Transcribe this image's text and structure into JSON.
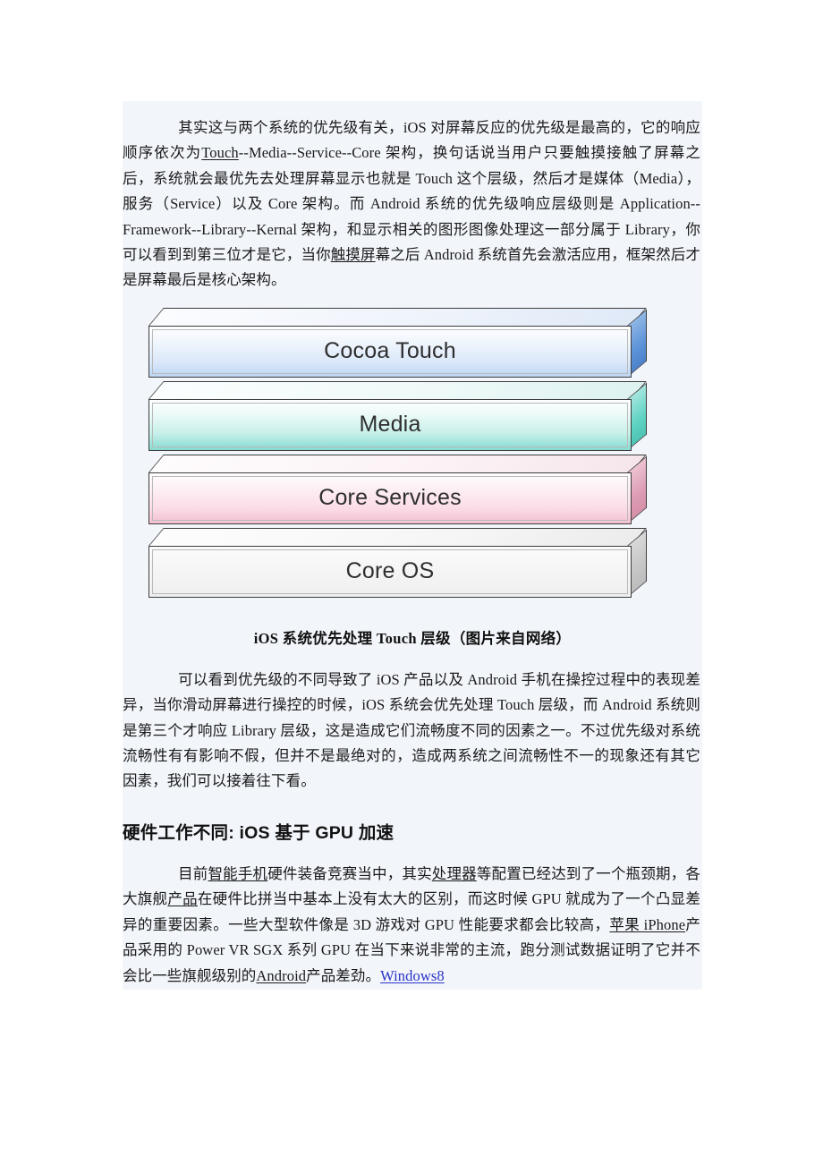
{
  "document": {
    "background_color": "#ffffff",
    "content_block_color": "#f2f5fa",
    "link_color": "#2a33c9"
  },
  "paragraphs": {
    "p1": {
      "seg_a": "其实这与两个系统的优先级有关，iOS 对屏幕反应的优先级是最高的，它的响应顺序依次为",
      "link_touch": "Touch",
      "seg_b": "--Media--Service--Core 架构，换句话说当用户只要触摸接触了屏幕之后，系统就会最优先去处理屏幕显示也就是 Touch 这个层级，然后才是媒体（Media），服务（Service）以及 Core 架构。而 Android 系统的优先级响应层级则是 Application--Framework--Library--Kernal 架构，和显示相关的图形图像处理这一部分属于 Library，你可以看到到第三位才是它，当你",
      "link_touch_screen": "触摸屏",
      "seg_c": "幕之后 Android 系统首先会激活应用，框架然后才是屏幕最后是核心架构。"
    },
    "p2": {
      "text": "可以看到优先级的不同导致了 iOS 产品以及 Android 手机在操控过程中的表现差异，当你滑动屏幕进行操控的时候，iOS 系统会优先处理 Touch 层级，而 Android 系统则是第三个才响应 Library 层级，这是造成它们流畅度不同的因素之一。不过优先级对系统流畅性有有影响不假，但并不是最绝对的，造成两系统之间流畅性不一的现象还有其它因素，我们可以接着往下看。"
    },
    "p3": {
      "seg_a": "目前",
      "link_smartphone": "智能手机",
      "seg_b": "硬件装备竞赛当中，其实",
      "link_processor": "处理器",
      "seg_c": "等配置已经达到了一个瓶颈期，各大旗舰",
      "link_product": "产品",
      "seg_d": "在硬件比拼当中基本上没有太大的区别，而这时候 GPU 就成为了一个凸显差异的重要因素。一些大型软件像是 3D 游戏对 GPU 性能要求都会比较高，",
      "link_apple_iphone": "苹果 iPhone",
      "seg_e": "产品采用的 Power VR SGX 系列 GPU 在当下来说非常的主流，跑分测试数据证明了它并不会比一些旗舰级别的",
      "link_android": "Android",
      "seg_f": "产品差劲。",
      "link_windows8": "Windows8"
    }
  },
  "heading": {
    "text": "硬件工作不同: iOS 基于 GPU 加速"
  },
  "figure": {
    "caption": "iOS 系统优先处理 Touch 层级（图片来自网络）",
    "layers": [
      {
        "id": "cocoa-touch",
        "label": "Cocoa Touch",
        "face_color": "#bcd6f4",
        "side_color": "#4b82cb"
      },
      {
        "id": "media",
        "label": "Media",
        "face_color": "#86dcd1",
        "side_color": "#4ec4b5"
      },
      {
        "id": "core-services",
        "label": "Core Services",
        "face_color": "#f4bfd1",
        "side_color": "#d68fa8"
      },
      {
        "id": "core-os",
        "label": "Core OS",
        "face_color": "#efefef",
        "side_color": "#bcbcbc"
      }
    ]
  }
}
